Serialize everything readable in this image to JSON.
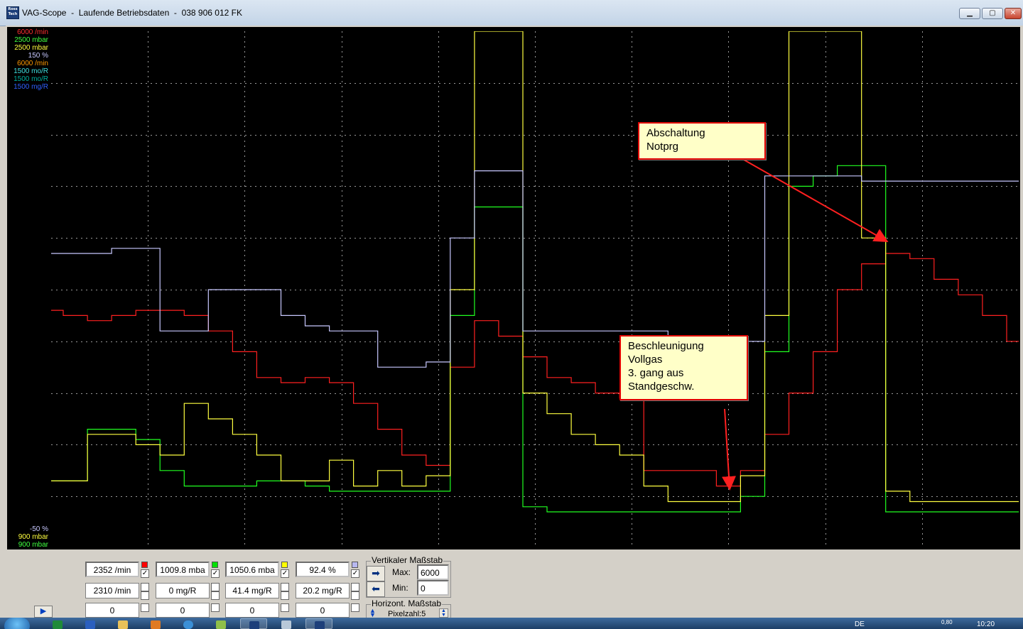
{
  "window": {
    "title": "VAG-Scope  -  Laufende Betriebsdaten  -  038 906 012 FK",
    "icon_label": "Ross\nTech"
  },
  "axis_top_labels": [
    {
      "text": "6000 /min",
      "color": "#ff3030"
    },
    {
      "text": "2500 mbar",
      "color": "#40ff40"
    },
    {
      "text": "2500 mbar",
      "color": "#ffff40"
    },
    {
      "text": "150 %",
      "color": "#c8c8ff"
    },
    {
      "text": "6000 /min",
      "color": "#ff9900"
    },
    {
      "text": "1500 mo/R",
      "color": "#40e0e0"
    },
    {
      "text": "1500 mo/R",
      "color": "#00b0a0"
    },
    {
      "text": "1500 mg/R",
      "color": "#3060ff"
    }
  ],
  "axis_bottom_labels": [
    {
      "text": "-50 %",
      "color": "#c8c8ff"
    },
    {
      "text": "900 mbar",
      "color": "#ffff40"
    },
    {
      "text": "900 mbar",
      "color": "#40ff40"
    }
  ],
  "colors": {
    "rpm": "#ff2020",
    "boost_spec": "#20ff20",
    "boost_actual": "#ffff40",
    "load": "#c8c8ff",
    "grid": "#9a9a9a",
    "background": "#000000"
  },
  "annotations": {
    "abschaltung": "Abschaltung\nNotprg",
    "beschleunigung": "Beschleunigung\nVollgas\n3. gang aus\nStandgeschw."
  },
  "channels": [
    {
      "value": "2352 /min",
      "value2": "2310 /min",
      "value3": "0",
      "swatch": "#ff0000",
      "checked": "✓"
    },
    {
      "value": "1009.8 mba",
      "value2": "0 mg/R",
      "value3": "0",
      "swatch": "#00e000",
      "checked": "✓"
    },
    {
      "value": "1050.6 mba",
      "value2": "41.4 mg/R",
      "value3": "0",
      "swatch": "#ffff00",
      "checked": "✓"
    },
    {
      "value": "92.4 %",
      "value2": "20.2 mg/R",
      "value3": "0",
      "swatch": "#b8b8f0",
      "checked": "✓"
    }
  ],
  "vertical_scale": {
    "title": "Vertikaler Maßstab",
    "max_label": "Max:",
    "max_value": "6000",
    "min_label": "Min:",
    "min_value": "0"
  },
  "horizontal_scale": {
    "title": "Horizont. Maßstab",
    "pixel_label": "Pixelzahl:5"
  },
  "tray": {
    "lang": "DE",
    "net": "0,80",
    "clock": "10:20"
  },
  "chart_data": {
    "type": "line",
    "title": "",
    "xlabel": "",
    "ylabel": "",
    "ylim": [
      0,
      1
    ],
    "grid": true,
    "note": "values normalized 0..1 within each channel's displayed min/max range",
    "x": [
      0,
      2,
      4,
      6,
      8,
      10,
      12,
      14,
      16,
      18,
      20,
      22,
      24,
      26,
      28,
      30,
      32,
      34,
      36,
      38,
      40,
      42,
      44,
      46,
      48,
      50,
      52,
      54,
      56,
      58,
      60,
      62,
      64,
      66,
      68,
      70,
      72,
      74,
      76,
      78,
      80,
      82,
      84,
      86,
      88,
      90,
      92,
      94,
      96,
      98,
      100
    ],
    "series": [
      {
        "name": "6000 /min",
        "color": "#ff2020",
        "values": [
          0.46,
          0.45,
          0.44,
          0.45,
          0.46,
          0.46,
          0.45,
          0.42,
          0.38,
          0.33,
          0.32,
          0.33,
          0.32,
          0.28,
          0.23,
          0.18,
          0.16,
          0.35,
          0.44,
          0.41,
          0.37,
          0.33,
          0.32,
          0.3,
          0.29,
          0.15,
          0.15,
          0.15,
          0.12,
          0.15,
          0.22,
          0.3,
          0.38,
          0.5,
          0.55,
          0.57,
          0.56,
          0.52,
          0.49,
          0.45,
          0.4
        ]
      },
      {
        "name": "2500 mbar",
        "color": "#20ff20",
        "values": [
          0.13,
          0.13,
          0.23,
          0.23,
          0.21,
          0.15,
          0.12,
          0.12,
          0.12,
          0.13,
          0.13,
          0.12,
          0.11,
          0.11,
          0.11,
          0.11,
          0.11,
          0.45,
          0.66,
          0.66,
          0.08,
          0.07,
          0.07,
          0.07,
          0.07,
          0.07,
          0.07,
          0.07,
          0.07,
          0.1,
          0.38,
          0.7,
          0.72,
          0.74,
          0.74,
          0.07,
          0.07,
          0.07,
          0.07,
          0.07,
          0.07
        ]
      },
      {
        "name": "2500 mbar",
        "color": "#ffff40",
        "values": [
          0.13,
          0.13,
          0.22,
          0.22,
          0.2,
          0.18,
          0.28,
          0.25,
          0.22,
          0.18,
          0.13,
          0.13,
          0.17,
          0.12,
          0.15,
          0.12,
          0.14,
          0.5,
          1.0,
          1.0,
          0.3,
          0.26,
          0.22,
          0.2,
          0.18,
          0.12,
          0.09,
          0.09,
          0.09,
          0.14,
          0.45,
          1.0,
          1.0,
          1.0,
          0.6,
          0.11,
          0.09,
          0.09,
          0.09,
          0.09,
          0.09
        ]
      },
      {
        "name": "150 %",
        "color": "#c8c8ff",
        "values": [
          0.57,
          0.57,
          0.57,
          0.58,
          0.58,
          0.42,
          0.42,
          0.5,
          0.5,
          0.5,
          0.45,
          0.43,
          0.42,
          0.42,
          0.35,
          0.35,
          0.36,
          0.6,
          0.73,
          0.73,
          0.42,
          0.42,
          0.42,
          0.42,
          0.42,
          0.42,
          0.35,
          0.35,
          0.35,
          0.4,
          0.72,
          0.72,
          0.72,
          0.72,
          0.71,
          0.71,
          0.71,
          0.71,
          0.71,
          0.71,
          0.71
        ]
      }
    ]
  }
}
